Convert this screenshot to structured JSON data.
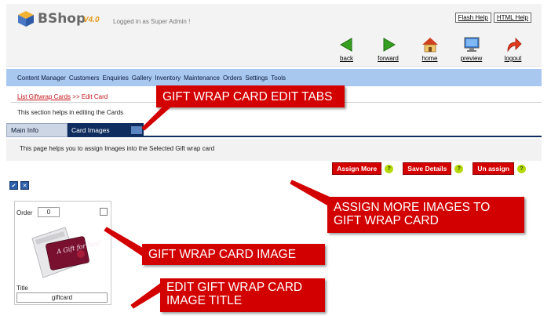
{
  "header": {
    "app_name": "BShop",
    "version": "V4.0",
    "logged_in": "Logged in as Super Admin !",
    "flash_help": "Flash Help",
    "html_help": "HTML Help"
  },
  "nav": {
    "back": "back",
    "forward": "forward",
    "home": "home",
    "preview": "preview",
    "logout": "logout"
  },
  "menu": {
    "items": [
      "Content Manager",
      "Customers",
      "Enquiries",
      "Gallery",
      "Inventory",
      "Maintenance",
      "Orders",
      "Settings",
      "Tools"
    ]
  },
  "breadcrumb": {
    "link": "List Giftwrap Cards",
    "separator": ">>",
    "current": "Edit Card"
  },
  "section_help": "This section helps in editing the Cards",
  "tabs": {
    "main_info": "Main Info",
    "card_images": "Card Images"
  },
  "assign_help": "This page helps you to assign Images into the Selected Gift wrap card",
  "actions": {
    "assign_more": "Assign More",
    "save_details": "Save Details",
    "un_assign": "Un assign",
    "help_mark": "?"
  },
  "card": {
    "order_label": "Order",
    "order_value": "0",
    "title_label": "Title",
    "title_value": "giftcard",
    "image_text": "A Gift for You!"
  },
  "callouts": {
    "tabs": "GIFT WRAP CARD EDIT TABS",
    "assign_line1": "ASSIGN MORE IMAGES TO",
    "assign_line2": "GIFT WRAP CARD",
    "image": "GIFT WRAP CARD IMAGE",
    "title_line1": "EDIT GIFT WRAP CARD",
    "title_line2": "IMAGE TITLE"
  },
  "colors": {
    "menu_bar": "#a9c8f0",
    "tab_active": "#0f2d5e",
    "action_red": "#d40000",
    "callout_red": "#d30000",
    "help_green": "#b6d90b",
    "breadcrumb_red": "#c4161c"
  }
}
